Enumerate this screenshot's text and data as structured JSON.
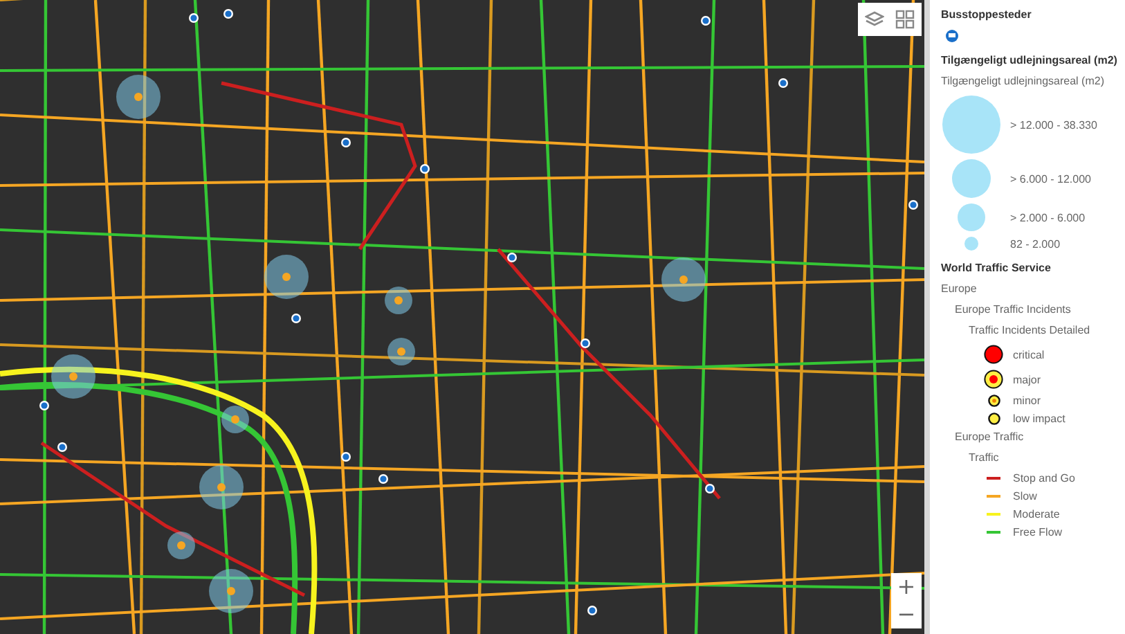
{
  "map": {
    "zoom_controls": [
      "+",
      "−"
    ]
  },
  "legend": {
    "layers": [
      {
        "title": "Busstoppesteder",
        "items": [
          {
            "kind": "bus-stop"
          }
        ]
      },
      {
        "title": "Tilgængeligt udlejningsareal (m2)",
        "subtitle": "Tilgængeligt udlejningsareal (m2)",
        "items": [
          {
            "kind": "circle-xl",
            "label": "> 12.000 - 38.330"
          },
          {
            "kind": "circle-l",
            "label": "> 6.000 - 12.000"
          },
          {
            "kind": "circle-m",
            "label": "> 2.000 - 6.000"
          },
          {
            "kind": "circle-s",
            "label": "82 - 2.000"
          }
        ]
      },
      {
        "title": "World Traffic Service",
        "children": [
          {
            "label": "Europe",
            "children": [
              {
                "label": "Europe Traffic Incidents",
                "children": [
                  {
                    "label": "Traffic Incidents Detailed",
                    "items": [
                      {
                        "kind": "critical",
                        "label": "critical"
                      },
                      {
                        "kind": "major",
                        "label": "major"
                      },
                      {
                        "kind": "minor",
                        "label": "minor"
                      },
                      {
                        "kind": "low",
                        "label": "low impact"
                      }
                    ]
                  }
                ]
              },
              {
                "label": "Europe Traffic",
                "children": [
                  {
                    "label": "Traffic",
                    "items": [
                      {
                        "kind": "line",
                        "label": "Stop and Go",
                        "color": "#cc1f1f"
                      },
                      {
                        "kind": "line",
                        "label": "Slow",
                        "color": "#f5a623"
                      },
                      {
                        "kind": "line",
                        "label": "Moderate",
                        "color": "#f7f31e"
                      },
                      {
                        "kind": "line",
                        "label": "Free Flow",
                        "color": "#35c635"
                      }
                    ]
                  }
                ]
              }
            ]
          }
        ]
      }
    ]
  }
}
